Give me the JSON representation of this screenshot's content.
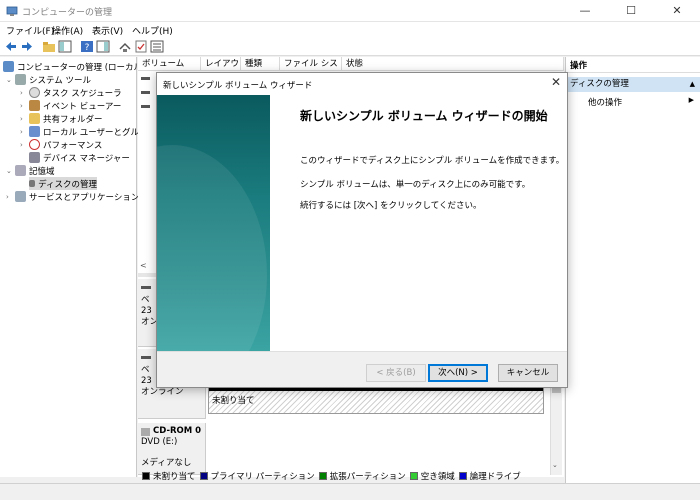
{
  "window": {
    "title": "コンピューターの管理"
  },
  "menu": [
    "ファイル(F)",
    "操作(A)",
    "表示(V)",
    "ヘルプ(H)"
  ],
  "tree": {
    "root": "コンピューターの管理 (ローカル)",
    "system_tools": "システム ツール",
    "task_scheduler": "タスク スケジューラ",
    "event_viewer": "イベント ビューアー",
    "shared_folders": "共有フォルダー",
    "local_users": "ローカル ユーザーとグループ",
    "performance": "パフォーマンス",
    "device_manager": "デバイス マネージャー",
    "storage": "記憶域",
    "disk_management": "ディスクの管理",
    "services": "サービスとアプリケーション"
  },
  "columns": [
    "ボリューム",
    "レイアウト",
    "種類",
    "ファイル システム",
    "状態"
  ],
  "disks": {
    "d0_a": "ベ",
    "d0_b": "23",
    "d0_c": "オン",
    "d1_a": "ベ",
    "d1_b": "23",
    "d1_c": "オンライン",
    "unallocated": "未割り当て",
    "cdrom": "CD-ROM 0",
    "cdrom_drive": "DVD (E:)",
    "cdrom_media": "メディアなし"
  },
  "legend": [
    {
      "label": "未割り当て",
      "color": "#000000"
    },
    {
      "label": "プライマリ パーティション",
      "color": "#000080"
    },
    {
      "label": "拡張パーティション",
      "color": "#008000"
    },
    {
      "label": "空き領域",
      "color": "#33cc33"
    },
    {
      "label": "論理ドライブ",
      "color": "#0000cc"
    }
  ],
  "actions": {
    "header": "操作",
    "section": "ディスクの管理",
    "other": "他の操作"
  },
  "wizard": {
    "title": "新しいシンプル ボリューム ウィザード",
    "heading": "新しいシンプル ボリューム ウィザードの開始",
    "p1": "このウィザードでディスク上にシンプル ボリュームを作成できます。",
    "p2": "シンプル ボリュームは、単一のディスク上にのみ可能です。",
    "p3": "続行するには [次へ] をクリックしてください。",
    "back": "< 戻る(B)",
    "next": "次へ(N) >",
    "cancel": "キャンセル"
  }
}
